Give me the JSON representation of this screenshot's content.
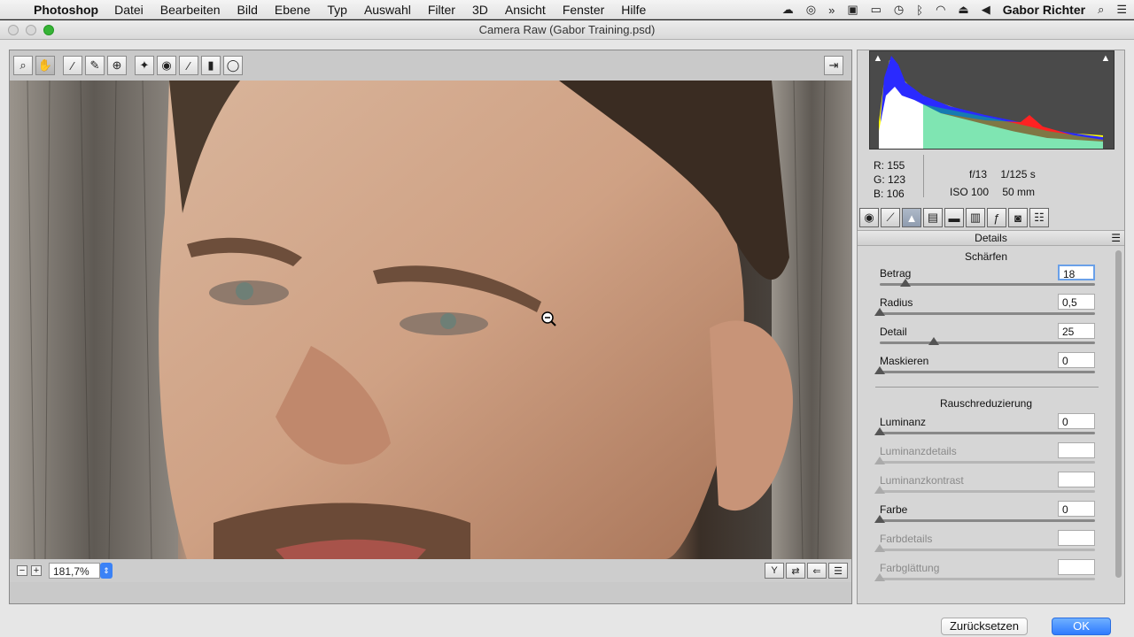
{
  "menubar": {
    "app": "Photoshop",
    "items": [
      "Datei",
      "Bearbeiten",
      "Bild",
      "Ebene",
      "Typ",
      "Auswahl",
      "Filter",
      "3D",
      "Ansicht",
      "Fenster",
      "Hilfe"
    ],
    "user": "Gabor Richter"
  },
  "window": {
    "title": "Camera Raw (Gabor Training.psd)"
  },
  "statusbar": {
    "zoom": "181,7%"
  },
  "readout": {
    "r": "R:  155",
    "g": "G:  123",
    "b": "B:  106",
    "aperture": "f/13",
    "shutter": "1/125 s",
    "iso": "ISO 100",
    "focal": "50 mm"
  },
  "panel": {
    "title": "Details",
    "sharpening": {
      "header": "Schärfen",
      "betrag": {
        "label": "Betrag",
        "value": "18",
        "fraction": 0.12
      },
      "radius": {
        "label": "Radius",
        "value": "0,5",
        "fraction": 0.0
      },
      "detail": {
        "label": "Detail",
        "value": "25",
        "fraction": 0.25
      },
      "maskieren": {
        "label": "Maskieren",
        "value": "0",
        "fraction": 0.0
      }
    },
    "noise": {
      "header": "Rauschreduzierung",
      "luminanz": {
        "label": "Luminanz",
        "value": "0",
        "fraction": 0.0
      },
      "luminanzdetails": {
        "label": "Luminanzdetails",
        "value": "",
        "fraction": 0.0
      },
      "luminanzkontrast": {
        "label": "Luminanzkontrast",
        "value": "",
        "fraction": 0.0
      },
      "farbe": {
        "label": "Farbe",
        "value": "0",
        "fraction": 0.0
      },
      "farbdetails": {
        "label": "Farbdetails",
        "value": "",
        "fraction": 0.0
      },
      "farbglaettung": {
        "label": "Farbglättung",
        "value": "",
        "fraction": 0.0
      }
    }
  },
  "buttons": {
    "reset": "Zurücksetzen",
    "ok": "OK"
  },
  "colors": {
    "accent": "#2f7bff",
    "histogram_bg": "#4a4a4a"
  }
}
